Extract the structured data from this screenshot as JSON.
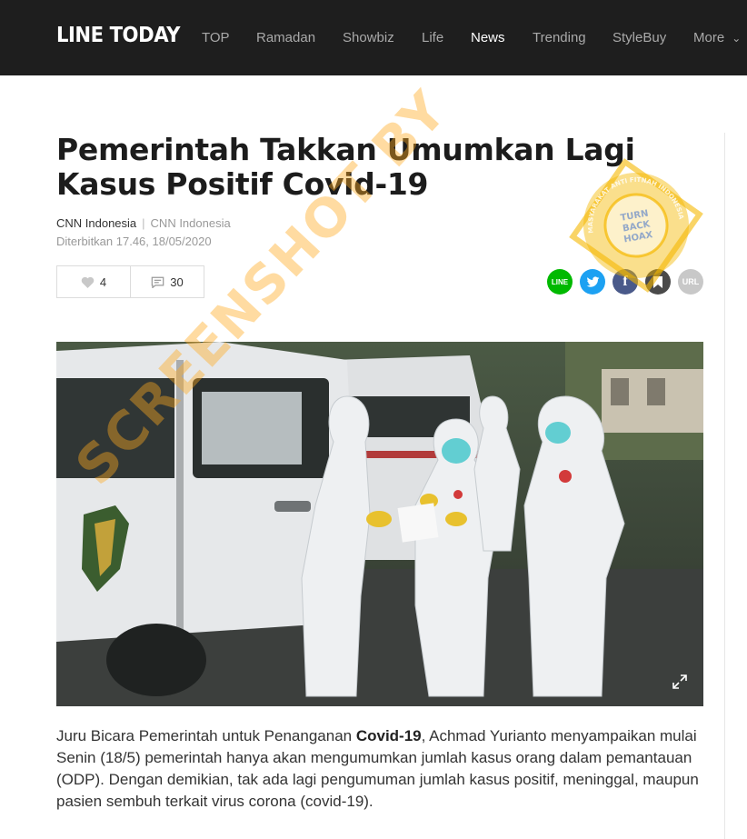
{
  "header": {
    "logo": "LINE TODAY",
    "nav": [
      {
        "label": "TOP",
        "active": false
      },
      {
        "label": "Ramadan",
        "active": false
      },
      {
        "label": "Showbiz",
        "active": false
      },
      {
        "label": "Life",
        "active": false
      },
      {
        "label": "News",
        "active": true
      },
      {
        "label": "Trending",
        "active": false
      },
      {
        "label": "StyleBuy",
        "active": false
      },
      {
        "label": "More",
        "active": false
      }
    ]
  },
  "article": {
    "title": "Pemerintah Takkan Umumkan Lagi Kasus Positif Covid-19",
    "source": "CNN Indonesia",
    "source_secondary": "CNN Indonesia",
    "published": "Diterbitkan 17.46, 18/05/2020",
    "likes": "4",
    "comments": "30",
    "body": {
      "before": "Juru Bicara Pemerintah untuk Penanganan ",
      "bold": "Covid-19",
      "after": ", Achmad Yurianto menyampaikan mulai Senin (18/5) pemerintah hanya akan mengumumkan jumlah kasus orang dalam pemantauan (ODP). Dengan demikian, tak ada lagi pengumuman jumlah kasus positif, meninggal, maupun pasien sembuh terkait virus corona (covid-19)."
    }
  },
  "share": {
    "line_label": "LINE",
    "url_label": "URL",
    "icons": [
      "line-icon",
      "twitter-icon",
      "facebook-icon",
      "bookmark-icon",
      "url-icon"
    ]
  },
  "watermark": {
    "text": "SCREENSHOT BY",
    "seal_ring": "MASYARAKAT ANTI FITNAH INDONESIA",
    "seal_center": [
      "TURN",
      "BACK",
      "HOAX"
    ],
    "color": "#f5b800"
  },
  "colors": {
    "topbar": "#1e1e1e",
    "line_green": "#00b900",
    "twitter_blue": "#1da1f2"
  }
}
